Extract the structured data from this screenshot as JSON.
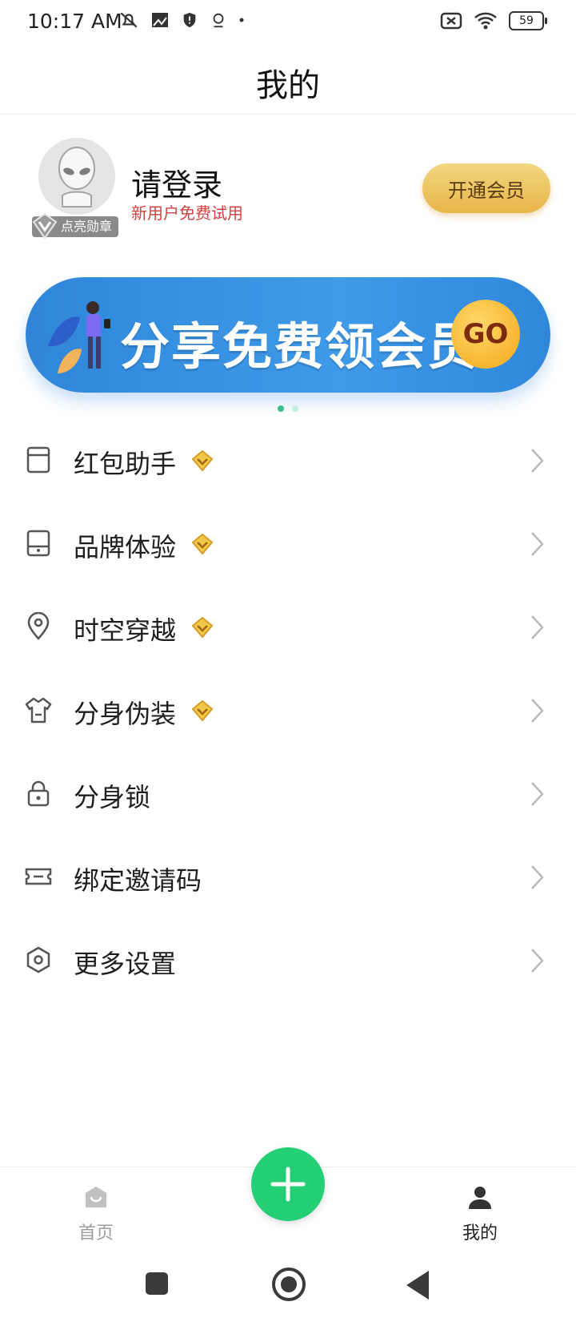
{
  "status_bar": {
    "time": "10:17 AM",
    "battery": "59"
  },
  "header": {
    "title": "我的"
  },
  "profile": {
    "badge_label": "点亮勋章",
    "login_text": "请登录",
    "trial_text": "新用户免费试用",
    "vip_button": "开通会员"
  },
  "banner": {
    "text": "分享免费领会员",
    "go": "GO",
    "slides": 2,
    "active_slide": 1
  },
  "menu": {
    "items": [
      {
        "label": "红包助手",
        "vip": true,
        "icon": "storage-icon"
      },
      {
        "label": "品牌体验",
        "vip": true,
        "icon": "phone-device-icon"
      },
      {
        "label": "时空穿越",
        "vip": true,
        "icon": "location-pin-icon"
      },
      {
        "label": "分身伪装",
        "vip": true,
        "icon": "shirt-icon"
      },
      {
        "label": "分身锁",
        "vip": false,
        "icon": "lock-icon"
      },
      {
        "label": "绑定邀请码",
        "vip": false,
        "icon": "ticket-icon"
      },
      {
        "label": "更多设置",
        "vip": false,
        "icon": "settings-hexagon-icon"
      }
    ]
  },
  "bottom_nav": {
    "home_label": "首页",
    "me_label": "我的"
  },
  "colors": {
    "accent_green": "#24cf76",
    "vip_gold": "#e8b64a",
    "trial_red": "#d34141",
    "banner_blue": "#3f9ae9"
  }
}
